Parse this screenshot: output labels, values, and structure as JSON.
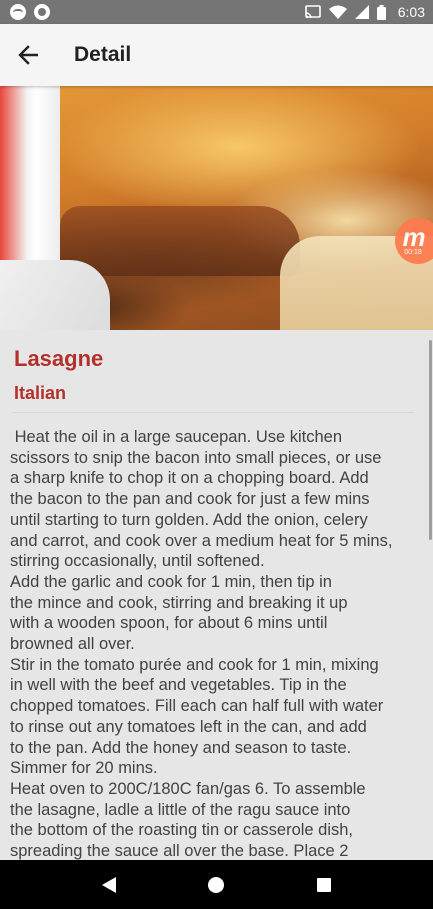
{
  "status_bar": {
    "time": "6:03",
    "left_icons": [
      "app-notification-icon",
      "notification-dot-icon"
    ],
    "right_icons": [
      "cast-icon",
      "wifi-icon",
      "signal-icon",
      "battery-icon"
    ]
  },
  "app_bar": {
    "title": "Detail",
    "back_icon": "arrow-back-icon"
  },
  "hero": {
    "badge_letter": "m",
    "badge_time": "00:18"
  },
  "recipe": {
    "title": "Lasagne",
    "cuisine": "Italian",
    "instructions": " Heat the oil in a large saucepan. Use kitchen\nscissors to snip the bacon into small pieces, or use\na sharp knife to chop it on a chopping board. Add\nthe bacon to the pan and cook for just a few mins\nuntil starting to turn golden. Add the onion, celery\nand carrot, and cook over a medium heat for 5 mins,\nstirring occasionally, until softened.\nAdd the garlic and cook for 1 min, then tip in\nthe mince and cook, stirring and breaking it up\nwith a wooden spoon, for about 6 mins until\nbrowned all over.\nStir in the tomato purée and cook for 1 min, mixing\nin well with the beef and vegetables. Tip in the\nchopped tomatoes. Fill each can half full with water\nto rinse out any tomatoes left in the can, and add\nto the pan. Add the honey and season to taste.\nSimmer for 20 mins.\nHeat oven to 200C/180C fan/gas 6. To assemble\nthe lasagne, ladle a little of the ragu sauce into\nthe bottom of the roasting tin or casserole dish,\nspreading the sauce all over the base. Place 2"
  },
  "colors": {
    "accent": "#b3302b",
    "status_bar": "#757575",
    "app_bar": "#f5f5f5",
    "background": "#e6e6e6"
  },
  "nav_bar": {
    "icons": [
      "back-triangle-icon",
      "home-circle-icon",
      "recents-square-icon"
    ]
  }
}
